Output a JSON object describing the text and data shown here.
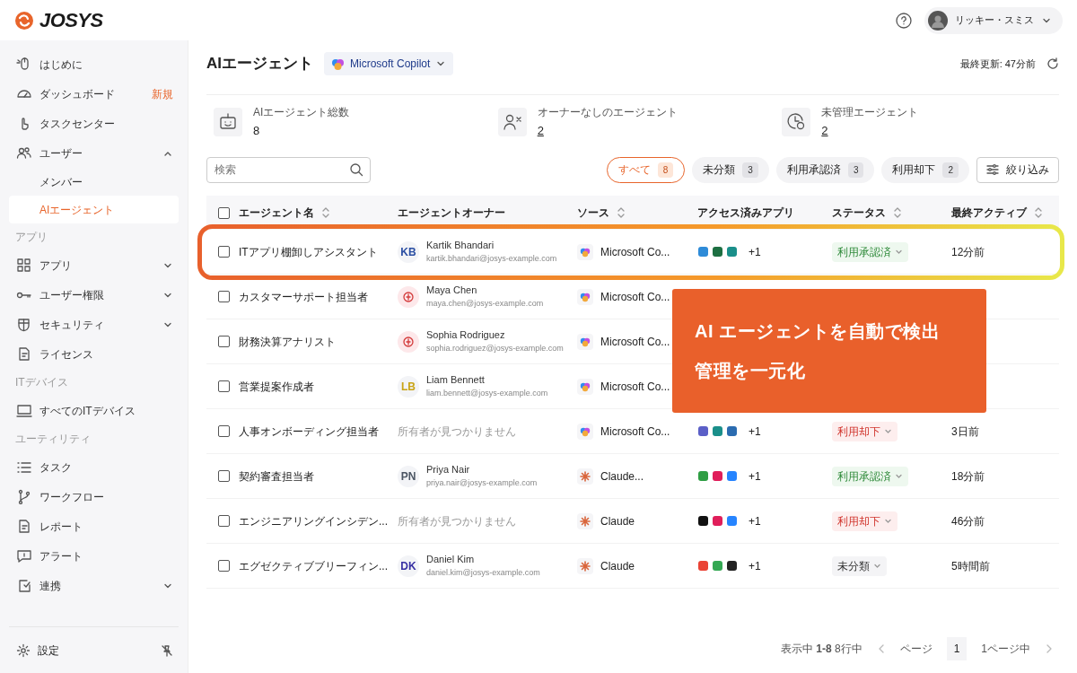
{
  "brand": "JOSYS",
  "user": {
    "name": "リッキー・スミス"
  },
  "sidebar": {
    "items": [
      {
        "label": "はじめに",
        "kind": "item"
      },
      {
        "label": "ダッシュボード",
        "kind": "item",
        "badge": "新規"
      },
      {
        "label": "タスクセンター",
        "kind": "item"
      },
      {
        "label": "ユーザー",
        "kind": "item",
        "expanded": true,
        "children": [
          {
            "label": "メンバー",
            "selected": false
          },
          {
            "label": "AIエージェント",
            "selected": true
          }
        ]
      },
      {
        "label": "アプリ",
        "kind": "section"
      },
      {
        "label": "アプリ",
        "kind": "item",
        "expanded": false
      },
      {
        "label": "ユーザー権限",
        "kind": "item",
        "expanded": false
      },
      {
        "label": "セキュリティ",
        "kind": "item",
        "expanded": false
      },
      {
        "label": "ライセンス",
        "kind": "item"
      },
      {
        "label": "ITデバイス",
        "kind": "section"
      },
      {
        "label": "すべてのITデバイス",
        "kind": "item"
      },
      {
        "label": "ユーティリティ",
        "kind": "section"
      },
      {
        "label": "タスク",
        "kind": "item"
      },
      {
        "label": "ワークフロー",
        "kind": "item"
      },
      {
        "label": "レポート",
        "kind": "item"
      },
      {
        "label": "アラート",
        "kind": "item"
      },
      {
        "label": "連携",
        "kind": "item",
        "expanded": false
      }
    ],
    "footer": {
      "label": "設定"
    }
  },
  "page": {
    "title": "AIエージェント",
    "source_selector": "Microsoft Copilot",
    "last_updated": "最終更新: 47分前"
  },
  "stats": [
    {
      "label": "AIエージェント総数",
      "value": "8",
      "linked": false
    },
    {
      "label": "オーナーなしのエージェント",
      "value": "2",
      "linked": true
    },
    {
      "label": "未管理エージェント",
      "value": "2",
      "linked": true
    }
  ],
  "search": {
    "placeholder": "検索"
  },
  "filters": [
    {
      "label": "すべて",
      "count": "8",
      "selected": true
    },
    {
      "label": "未分類",
      "count": "3",
      "selected": false
    },
    {
      "label": "利用承認済",
      "count": "3",
      "selected": false
    },
    {
      "label": "利用却下",
      "count": "2",
      "selected": false
    }
  ],
  "filter_button": "絞り込み",
  "table": {
    "select_all": {
      "checked": false
    },
    "columns": [
      {
        "label": "エージェント名",
        "sortable": true
      },
      {
        "label": "エージェントオーナー",
        "sortable": false
      },
      {
        "label": "ソース",
        "sortable": true
      },
      {
        "label": "アクセス済みアプリ",
        "sortable": false
      },
      {
        "label": "ステータス",
        "sortable": true
      },
      {
        "label": "最終アクティブ",
        "sortable": true
      }
    ],
    "rows": [
      {
        "name": "ITアプリ棚卸しアシスタント",
        "checked": false,
        "highlighted": true,
        "owner": {
          "kind": "initials",
          "initials": "KB",
          "color": "#2b4fa3",
          "name": "Kartik Bhandari",
          "email": "kartik.bhandari@josys-example.com"
        },
        "source": {
          "kind": "copilot",
          "label": "Microsoft Co..."
        },
        "apps_more": "+1",
        "status": {
          "kind": "approved",
          "label": "利用承認済"
        },
        "last_active": "12分前"
      },
      {
        "name": "カスタマーサポート担当者",
        "checked": false,
        "highlighted": false,
        "owner": {
          "kind": "logo",
          "name": "Maya Chen",
          "email": "maya.chen@josys-example.com"
        },
        "source": {
          "kind": "copilot",
          "label": "Microsoft Co..."
        }
      },
      {
        "name": "財務決算アナリスト",
        "checked": false,
        "highlighted": false,
        "owner": {
          "kind": "logo",
          "name": "Sophia Rodriguez",
          "email": "sophia.rodriguez@josys-example.com"
        },
        "source": {
          "kind": "copilot",
          "label": "Microsoft Co..."
        }
      },
      {
        "name": "営業提案作成者",
        "checked": false,
        "highlighted": false,
        "owner": {
          "kind": "initials",
          "initials": "LB",
          "color": "#c9a416",
          "name": "Liam Bennett",
          "email": "liam.bennett@josys-example.com"
        },
        "source": {
          "kind": "copilot",
          "label": "Microsoft Co..."
        }
      },
      {
        "name": "人事オンボーディング担当者",
        "checked": false,
        "highlighted": false,
        "owner": {
          "kind": "none",
          "label": "所有者が見つかりません"
        },
        "source": {
          "kind": "copilot",
          "label": "Microsoft Co..."
        },
        "apps_more": "+1",
        "status": {
          "kind": "rejected",
          "label": "利用却下"
        },
        "last_active": "3日前"
      },
      {
        "name": "契約審査担当者",
        "checked": false,
        "highlighted": false,
        "owner": {
          "kind": "initials",
          "initials": "PN",
          "color": "#4b5563",
          "name": "Priya Nair",
          "email": "priya.nair@josys-example.com"
        },
        "source": {
          "kind": "claude",
          "label": "Claude..."
        },
        "apps_more": "+1",
        "status": {
          "kind": "approved",
          "label": "利用承認済"
        },
        "last_active": "18分前"
      },
      {
        "name": "エンジニアリングインシデン...",
        "checked": false,
        "highlighted": false,
        "owner": {
          "kind": "none",
          "label": "所有者が見つかりません"
        },
        "source": {
          "kind": "claude",
          "label": "Claude"
        },
        "apps_more": "+1",
        "status": {
          "kind": "rejected",
          "label": "利用却下"
        },
        "last_active": "46分前"
      },
      {
        "name": "エグゼクティブブリーフィン...",
        "checked": false,
        "highlighted": false,
        "owner": {
          "kind": "initials",
          "initials": "DK",
          "color": "#3730a3",
          "name": "Daniel Kim",
          "email": "daniel.kim@josys-example.com"
        },
        "source": {
          "kind": "claude",
          "label": "Claude"
        },
        "apps_more": "+1",
        "status": {
          "kind": "unclassified",
          "label": "未分類"
        },
        "last_active": "5時間前"
      }
    ]
  },
  "pagination": {
    "summary": "表示中 **1-8** 8行中",
    "page_label": "ページ",
    "page": "1",
    "total": "1ページ中"
  },
  "callout": {
    "lines": [
      "AI エージェントを自動で検出",
      "管理を一元化"
    ]
  }
}
